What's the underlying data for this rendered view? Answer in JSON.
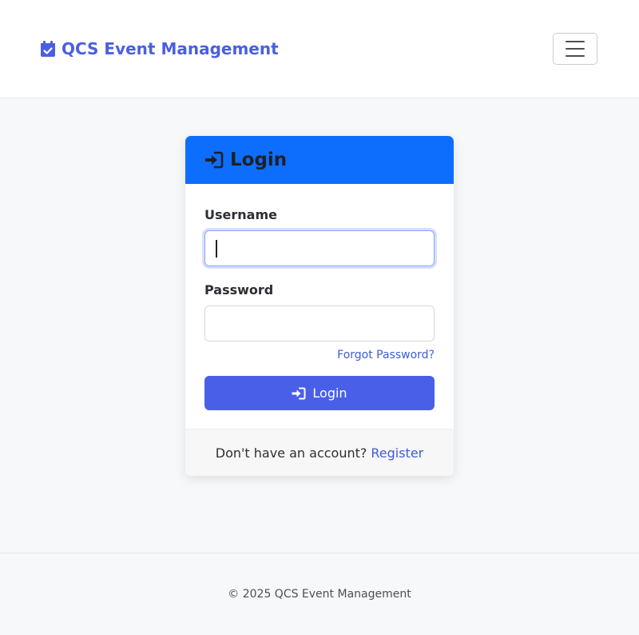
{
  "navbar": {
    "brand_text": "QCS Event Management",
    "brand_icon": "calendar-check-icon",
    "toggler_icon": "hamburger-icon"
  },
  "login_card": {
    "header_icon": "sign-in-icon",
    "title": "Login",
    "username_label": "Username",
    "username_value": "",
    "password_label": "Password",
    "password_value": "",
    "forgot_password": "Forgot Password?",
    "submit_label": "Login",
    "footer_prompt": "Don't have an account?",
    "register_link": "Register"
  },
  "footer": {
    "copyright": "© 2025 QCS Event Management"
  },
  "colors": {
    "brand": "#4a5fe0",
    "card_header": "#0d6efd",
    "button": "#4a5fe8",
    "link": "#3f5cd8"
  }
}
